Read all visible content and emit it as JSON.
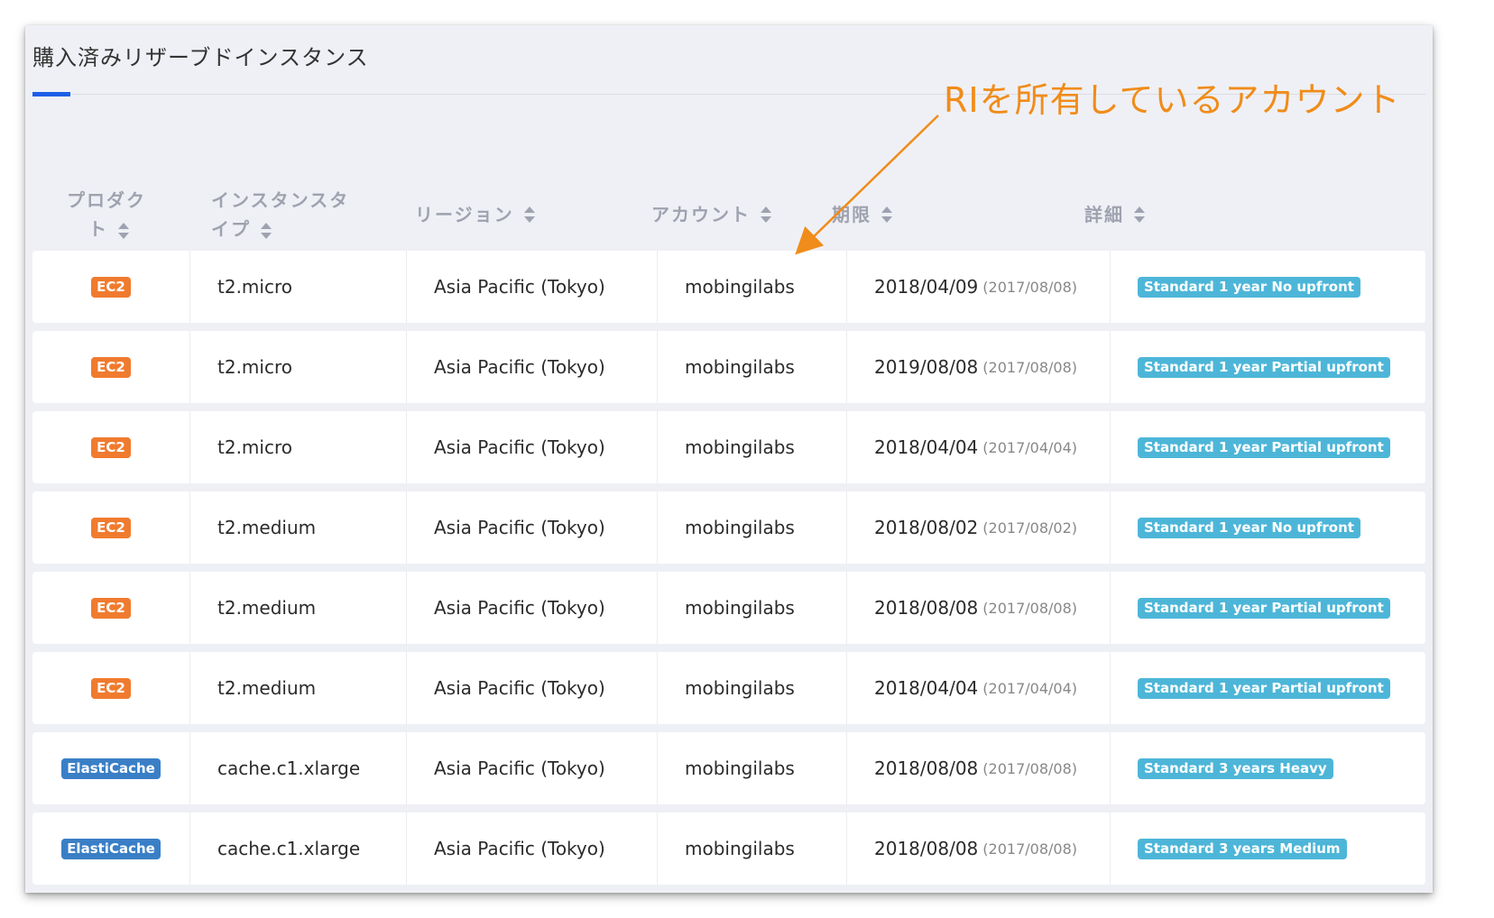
{
  "page_title": "購入済みリザーブドインスタンス",
  "annotation": "RIを所有しているアカウント",
  "colors": {
    "accent_tab": "#1d5ee8",
    "annotation": "#f08c1a",
    "badge_ec2": "#f07b2e",
    "badge_elasticache": "#3a7fc6",
    "badge_detail": "#4db6d8"
  },
  "columns": [
    {
      "label_lines": [
        "プロダク",
        "ト"
      ],
      "sort_icon": "sort-icon"
    },
    {
      "label_lines": [
        "インスタンスタ",
        "イプ"
      ],
      "sort_icon": "sort-icon"
    },
    {
      "label_lines": [
        "リージョン"
      ],
      "sort_icon": "sort-icon"
    },
    {
      "label_lines": [
        "アカウント"
      ],
      "sort_icon": "sort-icon"
    },
    {
      "label_lines": [
        "期限"
      ],
      "sort_icon": "sort-icon"
    },
    {
      "label_lines": [
        "詳細"
      ],
      "sort_icon": "sort-icon"
    }
  ],
  "rows": [
    {
      "product": "EC2",
      "product_type": "ec2",
      "instance_type": "t2.micro",
      "region": "Asia Pacific (Tokyo)",
      "account": "mobingilabs",
      "expiry": "2018/04/09",
      "start": "(2017/08/08)",
      "detail": "Standard 1 year No upfront"
    },
    {
      "product": "EC2",
      "product_type": "ec2",
      "instance_type": "t2.micro",
      "region": "Asia Pacific (Tokyo)",
      "account": "mobingilabs",
      "expiry": "2019/08/08",
      "start": "(2017/08/08)",
      "detail": "Standard 1 year Partial upfront"
    },
    {
      "product": "EC2",
      "product_type": "ec2",
      "instance_type": "t2.micro",
      "region": "Asia Pacific (Tokyo)",
      "account": "mobingilabs",
      "expiry": "2018/04/04",
      "start": "(2017/04/04)",
      "detail": "Standard 1 year Partial upfront"
    },
    {
      "product": "EC2",
      "product_type": "ec2",
      "instance_type": "t2.medium",
      "region": "Asia Pacific (Tokyo)",
      "account": "mobingilabs",
      "expiry": "2018/08/02",
      "start": "(2017/08/02)",
      "detail": "Standard 1 year No upfront"
    },
    {
      "product": "EC2",
      "product_type": "ec2",
      "instance_type": "t2.medium",
      "region": "Asia Pacific (Tokyo)",
      "account": "mobingilabs",
      "expiry": "2018/08/08",
      "start": "(2017/08/08)",
      "detail": "Standard 1 year Partial upfront"
    },
    {
      "product": "EC2",
      "product_type": "ec2",
      "instance_type": "t2.medium",
      "region": "Asia Pacific (Tokyo)",
      "account": "mobingilabs",
      "expiry": "2018/04/04",
      "start": "(2017/04/04)",
      "detail": "Standard 1 year Partial upfront"
    },
    {
      "product": "ElastiCache",
      "product_type": "elasticache",
      "instance_type": "cache.c1.xlarge",
      "region": "Asia Pacific (Tokyo)",
      "account": "mobingilabs",
      "expiry": "2018/08/08",
      "start": "(2017/08/08)",
      "detail": "Standard 3 years Heavy"
    },
    {
      "product": "ElastiCache",
      "product_type": "elasticache",
      "instance_type": "cache.c1.xlarge",
      "region": "Asia Pacific (Tokyo)",
      "account": "mobingilabs",
      "expiry": "2018/08/08",
      "start": "(2017/08/08)",
      "detail": "Standard 3 years Medium"
    }
  ]
}
